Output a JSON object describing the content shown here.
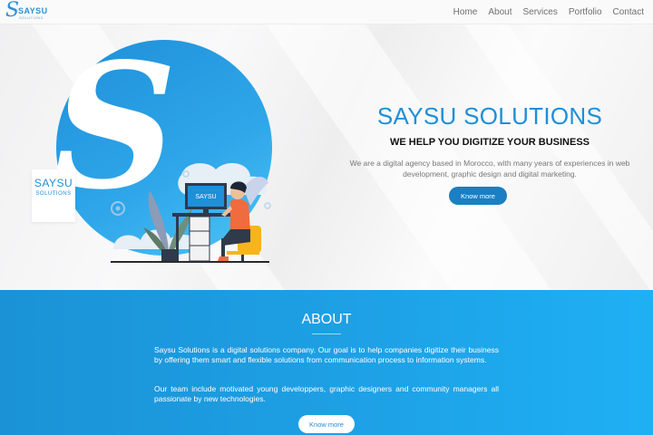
{
  "nav": {
    "logo_word": "SAYSU",
    "logo_sub": "SOLUTIONS",
    "items": [
      "Home",
      "About",
      "Services",
      "Portfolio",
      "Contact"
    ]
  },
  "hero": {
    "badge_top": "SAYSU",
    "badge_bottom": "SOLUTIONS",
    "monitor_text": "SAYSU",
    "title": "SAYSU SOLUTIONS",
    "subtitle": "WE HELP YOU DIGITIZE YOUR BUSINESS",
    "description": "We are a digital agency based in Morocco, with many years of experiences in web development, graphic design and digital marketing.",
    "button": "Know more"
  },
  "about": {
    "title": "ABOUT",
    "paragraph1": "Saysu Solutions is a digital solutions company. Our goal is to help companies digitize their business by offering them smart and flexible solutions from communication process to information systems.",
    "paragraph2": "Our team include motivated young developpers, graphic designers and community managers all passionate by new technologies.",
    "button": "Know more"
  },
  "colors": {
    "brand_blue": "#1f8fd8",
    "button_blue": "#1a7fc4",
    "about_bg": "#1ea2e7"
  }
}
